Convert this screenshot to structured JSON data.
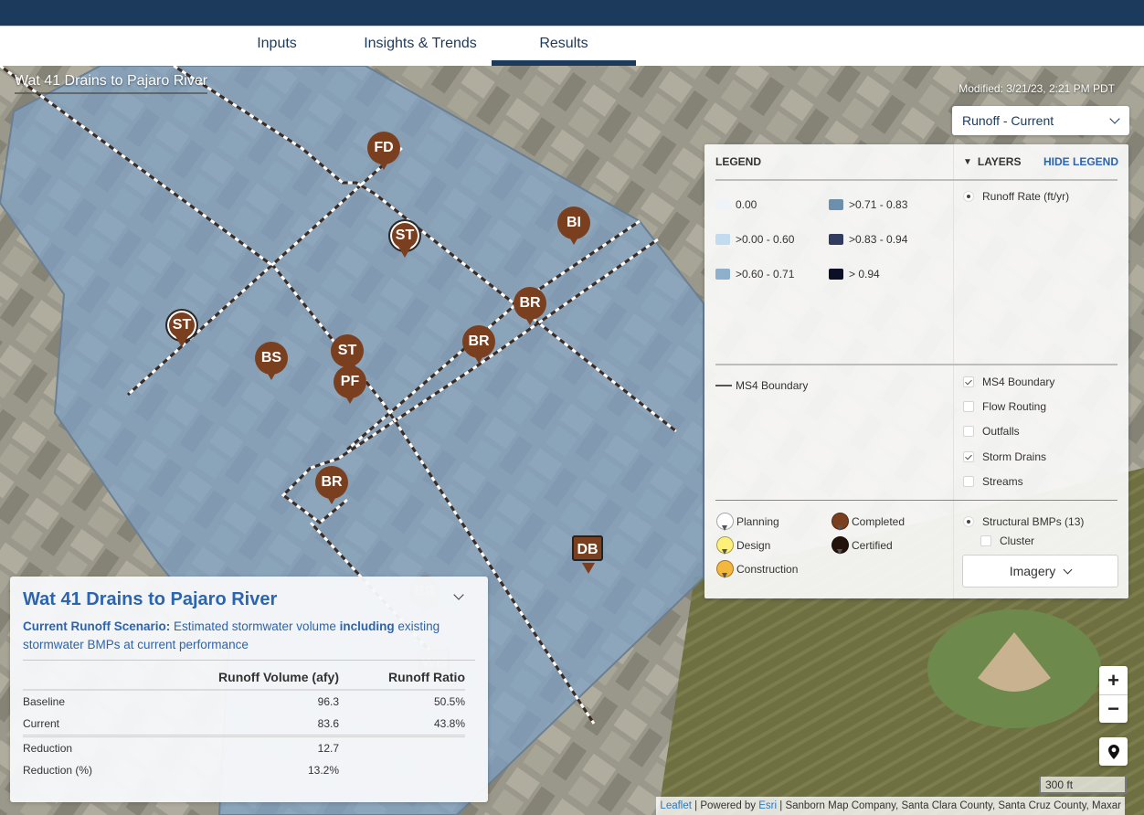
{
  "nav": {
    "tabs": [
      {
        "label": "Inputs",
        "active": false
      },
      {
        "label": "Insights & Trends",
        "active": false
      },
      {
        "label": "Results",
        "active": true
      }
    ]
  },
  "map": {
    "title": "Wat 41 Drains to Pajaro River",
    "modified": "Modified: 3/21/23, 2:21 PM PDT",
    "scenario_select": {
      "value": "Runoff - Current"
    },
    "markers": [
      {
        "label": "FD",
        "style": "pin"
      },
      {
        "label": "ST",
        "style": "ringed"
      },
      {
        "label": "BI",
        "style": "pin"
      },
      {
        "label": "BR",
        "style": "pin"
      },
      {
        "label": "ST",
        "style": "ringed"
      },
      {
        "label": "BS",
        "style": "pin"
      },
      {
        "label": "ST",
        "style": "pin"
      },
      {
        "label": "PF",
        "style": "pin"
      },
      {
        "label": "BR",
        "style": "pin"
      },
      {
        "label": "BR",
        "style": "pin"
      },
      {
        "label": "DB",
        "style": "square"
      },
      {
        "label": "BR",
        "style": "faded"
      },
      {
        "label": "WB",
        "style": "faded"
      }
    ],
    "colors": {
      "watershed_fill": "#7fa3c8",
      "marker_completed": "#7a3f1e",
      "nav_bar": "#1b3a5c",
      "link": "#2a64b2"
    }
  },
  "legend": {
    "title": "LEGEND",
    "layers_title": "LAYERS",
    "hide_label": "HIDE LEGEND",
    "runoff_classes": [
      {
        "label": "0.00",
        "color": "#eef3f8"
      },
      {
        "label": ">0.00 - 0.60",
        "color": "#c3dbf0"
      },
      {
        "label": ">0.60 - 0.71",
        "color": "#8fb0cc"
      },
      {
        "label": ">0.71 - 0.83",
        "color": "#6c8fab"
      },
      {
        "label": ">0.83 - 0.94",
        "color": "#323c5e"
      },
      {
        "label": "> 0.94",
        "color": "#0c0f26"
      }
    ],
    "runoff_layer": {
      "label": "Runoff Rate (ft/yr)",
      "selected": true
    },
    "boundary_label": "MS4 Boundary",
    "overlay_layers": [
      {
        "label": "MS4 Boundary",
        "checked": true
      },
      {
        "label": "Flow Routing",
        "checked": false
      },
      {
        "label": "Outfalls",
        "checked": false
      },
      {
        "label": "Storm Drains",
        "checked": true
      },
      {
        "label": "Streams",
        "checked": false
      }
    ],
    "bmp_statuses": [
      {
        "label": "Planning",
        "color": "#ffffff"
      },
      {
        "label": "Design",
        "color": "#fdf07a"
      },
      {
        "label": "Construction",
        "color": "#f4b73e"
      },
      {
        "label": "Completed",
        "color": "#7a3f1e"
      },
      {
        "label": "Certified",
        "color": "#24130b"
      }
    ],
    "bmp_layer": {
      "label": "Structural BMPs (13)",
      "selected": true
    },
    "cluster": {
      "label": "Cluster",
      "checked": false
    },
    "basemap_select": {
      "value": "Imagery"
    }
  },
  "info_panel": {
    "title": "Wat 41 Drains to Pajaro River",
    "desc_bold": "Current Runoff Scenario:",
    "desc_part1": " Estimated stormwater volume ",
    "desc_em": "including",
    "desc_part2": " existing stormwater BMPs at current performance",
    "columns": [
      "",
      "Runoff Volume (afy)",
      "Runoff Ratio"
    ],
    "rows": [
      {
        "label": "Baseline",
        "volume": "96.3",
        "ratio": "50.5%"
      },
      {
        "label": "Current",
        "volume": "83.6",
        "ratio": "43.8%"
      },
      {
        "label": "Reduction",
        "volume": "12.7",
        "ratio": ""
      },
      {
        "label": "Reduction (%)",
        "volume": "13.2%",
        "ratio": ""
      }
    ]
  },
  "controls": {
    "zoom_in": "+",
    "zoom_out": "−",
    "scale": "300 ft"
  },
  "attribution": {
    "leaflet": "Leaflet",
    "sep1": " | Powered by ",
    "esri": "Esri",
    "rest": " | Sanborn Map Company, Santa Clara County, Santa Cruz County, Maxar"
  }
}
